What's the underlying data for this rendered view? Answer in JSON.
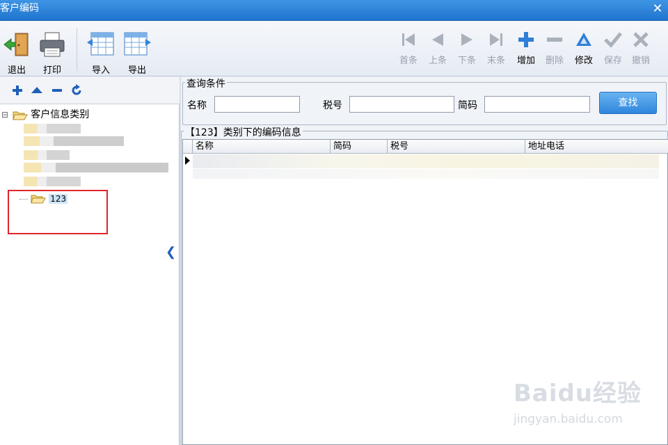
{
  "window": {
    "title": "客户编码",
    "close_glyph": "✕"
  },
  "toolbar": {
    "left_buttons": [
      {
        "label": "退出",
        "icon": "exit-door-icon"
      },
      {
        "label": "打印",
        "icon": "printer-icon"
      },
      {
        "label": "导入",
        "icon": "import-table-icon"
      },
      {
        "label": "导出",
        "icon": "export-table-icon"
      }
    ],
    "right_buttons": [
      {
        "label": "首条",
        "icon": "first-record-icon",
        "enabled": false
      },
      {
        "label": "上条",
        "icon": "prev-record-icon",
        "enabled": false
      },
      {
        "label": "下条",
        "icon": "next-record-icon",
        "enabled": false
      },
      {
        "label": "末条",
        "icon": "last-record-icon",
        "enabled": false
      },
      {
        "label": "增加",
        "icon": "add-icon",
        "enabled": true
      },
      {
        "label": "删除",
        "icon": "delete-icon",
        "enabled": false
      },
      {
        "label": "修改",
        "icon": "edit-icon",
        "enabled": true
      },
      {
        "label": "保存",
        "icon": "save-check-icon",
        "enabled": false
      },
      {
        "label": "撤销",
        "icon": "undo-x-icon",
        "enabled": false
      }
    ]
  },
  "tree": {
    "toolbar_icons": [
      "plus-icon",
      "up-icon",
      "minus-icon",
      "refresh-icon"
    ],
    "root_label": "客户信息类别",
    "expand_glyph": "⊟",
    "selected_leaf": "123"
  },
  "query": {
    "legend": "查询条件",
    "name_label": "名称",
    "name_value": "",
    "tax_label": "税号",
    "tax_value": "",
    "code_label": "简码",
    "code_value": "",
    "find_button": "查找"
  },
  "list": {
    "legend": "【123】类别下的编码信息",
    "columns": [
      "名称",
      "简码",
      "税号",
      "地址电话"
    ]
  },
  "watermark": {
    "brand": "Baidu经验",
    "url": "jingyan.baidu.com"
  },
  "colors": {
    "titlebar": "#2a83da",
    "accent_blue": "#1f5fb8",
    "highlight_red": "#e0242b"
  }
}
